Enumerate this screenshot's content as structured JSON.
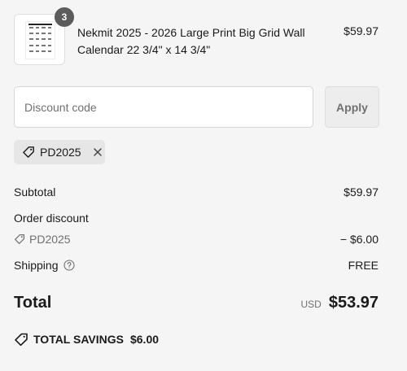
{
  "product": {
    "quantity": "3",
    "title": "Nekmit 2025 - 2026 Large Print Big Grid Wall Calendar 22 3/4\" x 14 3/4\"",
    "price": "$59.97"
  },
  "discount": {
    "placeholder": "Discount code",
    "apply_label": "Apply",
    "applied_code": "PD2025"
  },
  "summary": {
    "subtotal_label": "Subtotal",
    "subtotal_value": "$59.97",
    "order_discount_label": "Order discount",
    "discount_code": "PD2025",
    "discount_value": "− $6.00",
    "shipping_label": "Shipping",
    "shipping_value": "FREE",
    "total_label": "Total",
    "total_currency": "USD",
    "total_value": "$53.97",
    "savings_label": "TOTAL SAVINGS",
    "savings_value": "$6.00"
  },
  "icons": {
    "tag": "tag-icon",
    "close": "close-icon",
    "help": "question-circle-icon",
    "savings": "savings-tag-icon"
  },
  "colors": {
    "background": "#f5f5f5",
    "text": "#1a1a1a",
    "muted": "#707070",
    "badge": "#5c5c5c"
  }
}
